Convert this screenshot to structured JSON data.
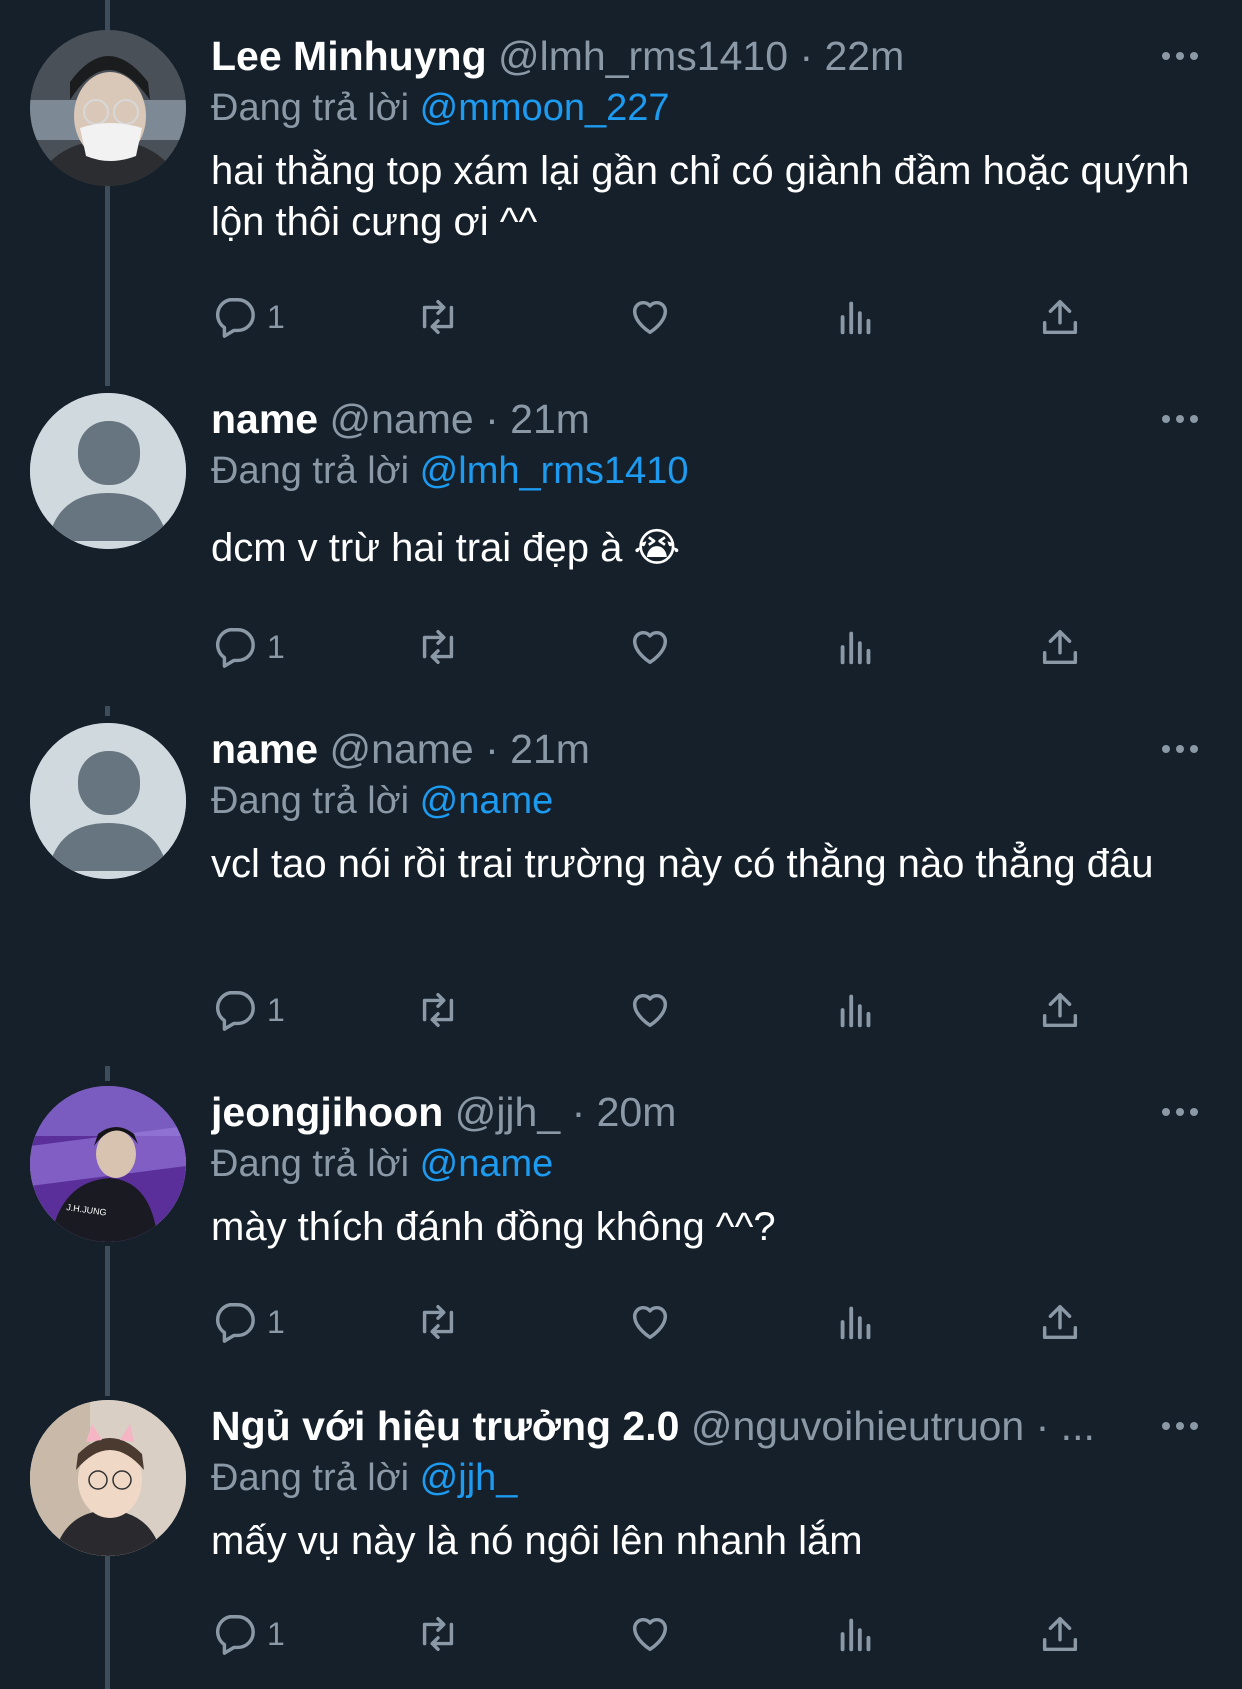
{
  "reply_prefix": "Đang trả lời",
  "tweets": [
    {
      "name": "Lee Minhuyng",
      "handle": "@lmh_rms1410",
      "separator": "·",
      "time": "22m",
      "reply_to": "@mmoon_227",
      "text": "hai thằng top xám lại gần chỉ có giành đầm hoặc quýnh lộn thôi cưng ơi ^^",
      "replies": "1"
    },
    {
      "name": "name",
      "handle": "@name",
      "separator": "·",
      "time": "21m",
      "reply_to": "@lmh_rms1410",
      "text": "dcm v trừ hai trai đẹp à 😭",
      "replies": "1"
    },
    {
      "name": "name",
      "handle": "@name",
      "separator": "·",
      "time": "21m",
      "reply_to": "@name",
      "text": "vcl tao nói rồi trai trường này có thằng nào thẳng đâu",
      "replies": "1"
    },
    {
      "name": "jeongjihoon",
      "handle": "@jjh_",
      "separator": "·",
      "time": "20m",
      "reply_to": "@name",
      "text": "mày thích đánh đồng không ^^?",
      "replies": "1",
      "avatar_jacket_text": "J.H.JUNG"
    },
    {
      "name": "Ngủ với hiệu trưởng 2.0",
      "handle": "@nguvoihieutruon",
      "separator": "· ...",
      "time": "",
      "reply_to": "@jjh_",
      "text": "mấy vụ này là nó ngôi lên nhanh lắm",
      "replies": "1"
    }
  ],
  "icons": {
    "reply": "reply-icon",
    "retweet": "retweet-icon",
    "like": "heart-icon",
    "views": "views-icon",
    "share": "share-icon",
    "more": "more-icon"
  },
  "colors": {
    "background": "#15202b",
    "link": "#1d9bf0",
    "secondary_text": "#8b98a5",
    "thread_line": "#3d4d5c"
  }
}
